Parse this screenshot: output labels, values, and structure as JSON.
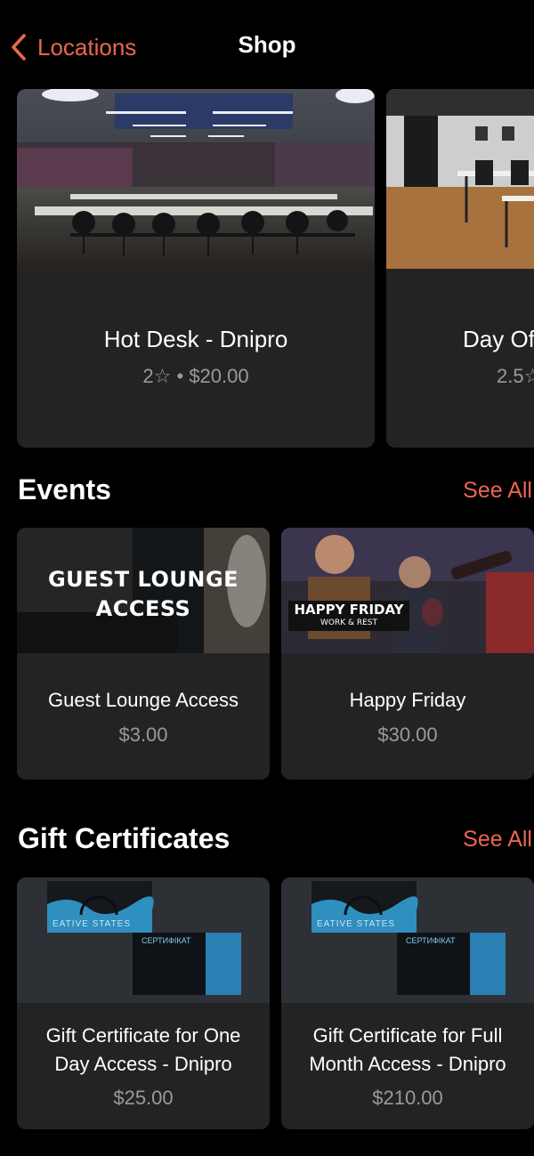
{
  "nav": {
    "back_label": "Locations",
    "title": "Shop"
  },
  "featured": [
    {
      "title": "Hot Desk - Dnipro",
      "rating": "2☆",
      "price": "$20.00"
    },
    {
      "title": "Day Of",
      "rating": "2.5☆",
      "price": ""
    }
  ],
  "events": {
    "title": "Events",
    "see_all": "See All",
    "items": [
      {
        "title": "Guest Lounge Access",
        "price": "$3.00",
        "image_text_line1": "GUEST LOUNGE",
        "image_text_line2": "ACCESS"
      },
      {
        "title": "Happy Friday",
        "price": "$30.00",
        "image_text_line1": "HAPPY FRIDAY",
        "image_text_line2": "WORK & REST"
      }
    ]
  },
  "gift_certificates": {
    "title": "Gift Certificates",
    "see_all": "See All",
    "items": [
      {
        "title_line1": "Gift Certificate for One",
        "title_line2": "Day Access - Dnipro",
        "price": "$25.00"
      },
      {
        "title_line1": "Gift Certificate for Full",
        "title_line2": "Month Access - Dnipro",
        "price": "$210.00"
      }
    ],
    "image_brand": "EATIVE STATES",
    "image_cert": "СЕРТИФІКАТ"
  },
  "colors": {
    "accent": "#e8674e",
    "card_bg": "#232325",
    "muted_text": "#9a9a9a"
  }
}
